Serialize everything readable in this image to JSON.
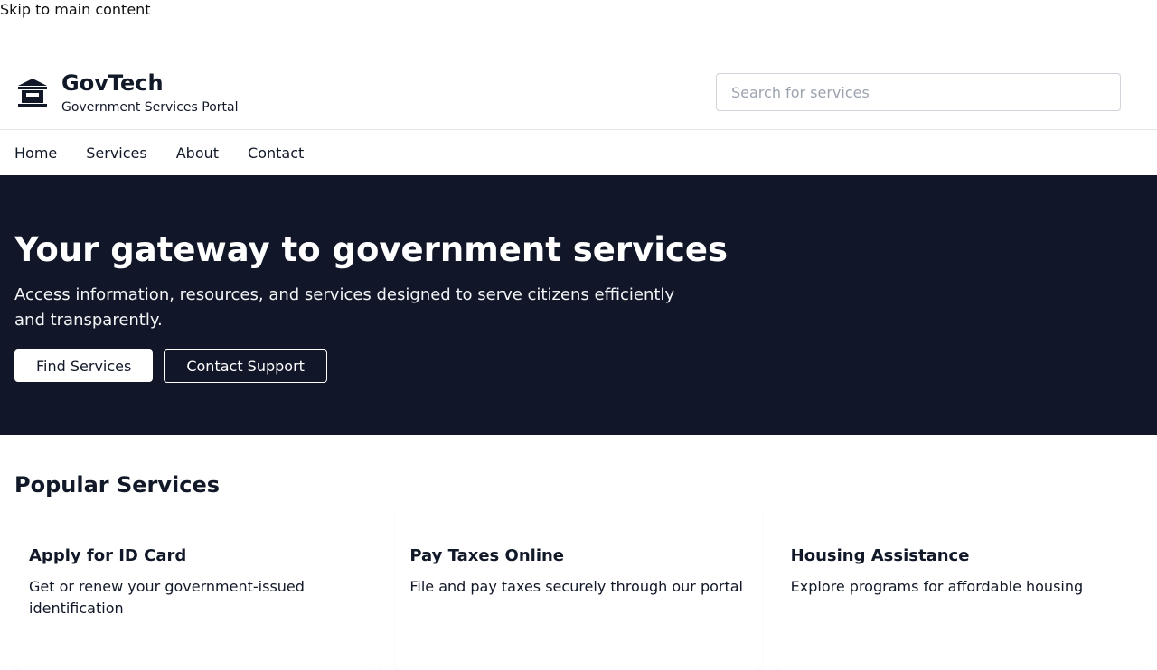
{
  "skip_link": "Skip to main content",
  "header": {
    "brand_name": "GovTech",
    "tagline": "Government Services Portal",
    "brand_icon": "government-building-icon",
    "search_placeholder": "Search for services"
  },
  "nav": {
    "items": [
      {
        "label": "Home"
      },
      {
        "label": "Services"
      },
      {
        "label": "About"
      },
      {
        "label": "Contact"
      }
    ]
  },
  "hero": {
    "title": "Your gateway to government services",
    "subtitle": "Access information, resources, and services designed to serve citizens efficiently and transparently.",
    "primary_button": "Find Services",
    "secondary_button": "Contact Support",
    "background_color": "#111729"
  },
  "popular": {
    "title": "Popular Services",
    "cards": [
      {
        "title": "Apply for ID Card",
        "description": "Get or renew your government-issued identification"
      },
      {
        "title": "Pay Taxes Online",
        "description": "File and pay taxes securely through our portal"
      },
      {
        "title": "Housing Assistance",
        "description": "Explore programs for affordable housing"
      }
    ]
  }
}
